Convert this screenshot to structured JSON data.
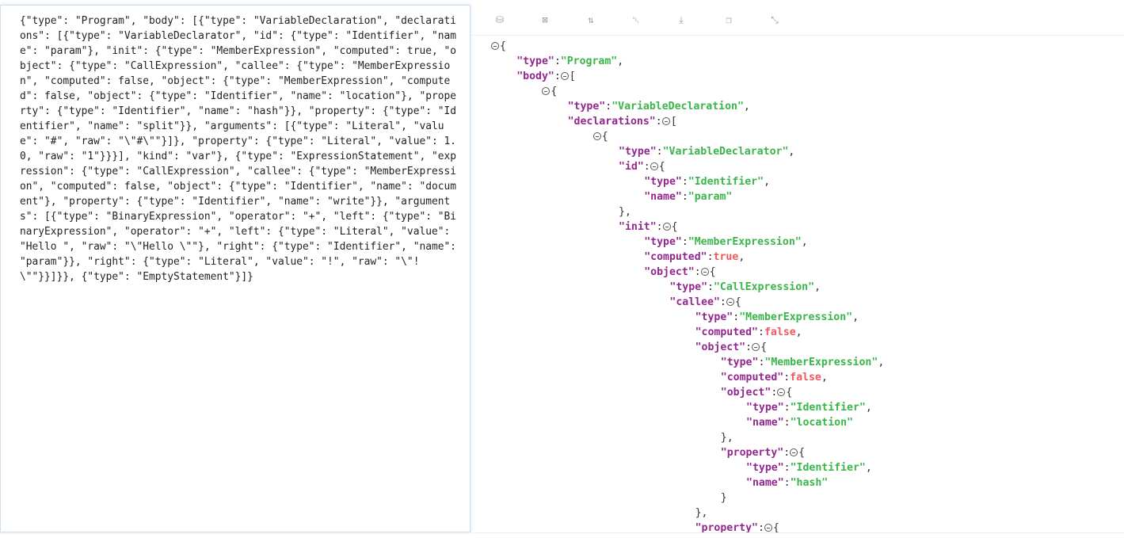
{
  "raw_json": "{\"type\": \"Program\", \"body\": [{\"type\": \"VariableDeclaration\", \"declarations\": [{\"type\": \"VariableDeclarator\", \"id\": {\"type\": \"Identifier\", \"name\": \"param\"}, \"init\": {\"type\": \"MemberExpression\", \"computed\": true, \"object\": {\"type\": \"CallExpression\", \"callee\": {\"type\": \"MemberExpression\", \"computed\": false, \"object\": {\"type\": \"MemberExpression\", \"computed\": false, \"object\": {\"type\": \"Identifier\", \"name\": \"location\"}, \"property\": {\"type\": \"Identifier\", \"name\": \"hash\"}}, \"property\": {\"type\": \"Identifier\", \"name\": \"split\"}}, \"arguments\": [{\"type\": \"Literal\", \"value\": \"#\", \"raw\": \"\\\"#\\\"\"}]}, \"property\": {\"type\": \"Literal\", \"value\": 1.0, \"raw\": \"1\"}}}], \"kind\": \"var\"}, {\"type\": \"ExpressionStatement\", \"expression\": {\"type\": \"CallExpression\", \"callee\": {\"type\": \"MemberExpression\", \"computed\": false, \"object\": {\"type\": \"Identifier\", \"name\": \"document\"}, \"property\": {\"type\": \"Identifier\", \"name\": \"write\"}}, \"arguments\": [{\"type\": \"BinaryExpression\", \"operator\": \"+\", \"left\": {\"type\": \"BinaryExpression\", \"operator\": \"+\", \"left\": {\"type\": \"Literal\", \"value\": \"Hello \", \"raw\": \"\\\"Hello \\\"\"}, \"right\": {\"type\": \"Identifier\", \"name\": \"param\"}}, \"right\": {\"type\": \"Literal\", \"value\": \"!\", \"raw\": \"\\\"!\\\"\"}}]}}, {\"type\": \"EmptyStatement\"}]}",
  "toolbar": [
    {
      "name": "database-icon",
      "glyph": "⛁"
    },
    {
      "name": "excel-icon",
      "glyph": "⊠"
    },
    {
      "name": "sort-icon",
      "glyph": "⇅"
    },
    {
      "name": "trash-icon",
      "glyph": "␡"
    },
    {
      "name": "download-icon",
      "glyph": "⤓"
    },
    {
      "name": "copy-icon",
      "glyph": "❐"
    },
    {
      "name": "collapse-icon",
      "glyph": "⤡"
    }
  ],
  "tree_lines": [
    {
      "d": 0,
      "p": [
        [
          "t",
          ""
        ],
        [
          "x",
          "{"
        ]
      ]
    },
    {
      "d": 1,
      "p": [
        [
          "k",
          "\"type\""
        ],
        [
          "x",
          ":"
        ],
        [
          "s",
          "\"Program\""
        ],
        [
          "x",
          ","
        ]
      ]
    },
    {
      "d": 1,
      "p": [
        [
          "k",
          "\"body\""
        ],
        [
          "x",
          ":"
        ],
        [
          "t",
          ""
        ],
        [
          "x",
          "["
        ]
      ]
    },
    {
      "d": 2,
      "p": [
        [
          "t",
          ""
        ],
        [
          "x",
          "{"
        ]
      ]
    },
    {
      "d": 3,
      "p": [
        [
          "k",
          "\"type\""
        ],
        [
          "x",
          ":"
        ],
        [
          "s",
          "\"VariableDeclaration\""
        ],
        [
          "x",
          ","
        ]
      ]
    },
    {
      "d": 3,
      "p": [
        [
          "k",
          "\"declarations\""
        ],
        [
          "x",
          ":"
        ],
        [
          "t",
          ""
        ],
        [
          "x",
          "["
        ]
      ]
    },
    {
      "d": 4,
      "p": [
        [
          "t",
          ""
        ],
        [
          "x",
          "{"
        ]
      ]
    },
    {
      "d": 5,
      "p": [
        [
          "k",
          "\"type\""
        ],
        [
          "x",
          ":"
        ],
        [
          "s",
          "\"VariableDeclarator\""
        ],
        [
          "x",
          ","
        ]
      ]
    },
    {
      "d": 5,
      "p": [
        [
          "k",
          "\"id\""
        ],
        [
          "x",
          ":"
        ],
        [
          "t",
          ""
        ],
        [
          "x",
          "{"
        ]
      ]
    },
    {
      "d": 6,
      "p": [
        [
          "k",
          "\"type\""
        ],
        [
          "x",
          ":"
        ],
        [
          "s",
          "\"Identifier\""
        ],
        [
          "x",
          ","
        ]
      ]
    },
    {
      "d": 6,
      "p": [
        [
          "k",
          "\"name\""
        ],
        [
          "x",
          ":"
        ],
        [
          "s",
          "\"param\""
        ]
      ]
    },
    {
      "d": 5,
      "p": [
        [
          "x",
          "},"
        ]
      ]
    },
    {
      "d": 5,
      "p": [
        [
          "k",
          "\"init\""
        ],
        [
          "x",
          ":"
        ],
        [
          "t",
          ""
        ],
        [
          "x",
          "{"
        ]
      ]
    },
    {
      "d": 6,
      "p": [
        [
          "k",
          "\"type\""
        ],
        [
          "x",
          ":"
        ],
        [
          "s",
          "\"MemberExpression\""
        ],
        [
          "x",
          ","
        ]
      ]
    },
    {
      "d": 6,
      "p": [
        [
          "k",
          "\"computed\""
        ],
        [
          "x",
          ":"
        ],
        [
          "b",
          "true"
        ],
        [
          "x",
          ","
        ]
      ]
    },
    {
      "d": 6,
      "p": [
        [
          "k",
          "\"object\""
        ],
        [
          "x",
          ":"
        ],
        [
          "t",
          ""
        ],
        [
          "x",
          "{"
        ]
      ]
    },
    {
      "d": 7,
      "p": [
        [
          "k",
          "\"type\""
        ],
        [
          "x",
          ":"
        ],
        [
          "s",
          "\"CallExpression\""
        ],
        [
          "x",
          ","
        ]
      ]
    },
    {
      "d": 7,
      "p": [
        [
          "k",
          "\"callee\""
        ],
        [
          "x",
          ":"
        ],
        [
          "t",
          ""
        ],
        [
          "x",
          "{"
        ]
      ]
    },
    {
      "d": 8,
      "p": [
        [
          "k",
          "\"type\""
        ],
        [
          "x",
          ":"
        ],
        [
          "s",
          "\"MemberExpression\""
        ],
        [
          "x",
          ","
        ]
      ]
    },
    {
      "d": 8,
      "p": [
        [
          "k",
          "\"computed\""
        ],
        [
          "x",
          ":"
        ],
        [
          "b",
          "false"
        ],
        [
          "x",
          ","
        ]
      ]
    },
    {
      "d": 8,
      "p": [
        [
          "k",
          "\"object\""
        ],
        [
          "x",
          ":"
        ],
        [
          "t",
          ""
        ],
        [
          "x",
          "{"
        ]
      ]
    },
    {
      "d": 9,
      "p": [
        [
          "k",
          "\"type\""
        ],
        [
          "x",
          ":"
        ],
        [
          "s",
          "\"MemberExpression\""
        ],
        [
          "x",
          ","
        ]
      ]
    },
    {
      "d": 9,
      "p": [
        [
          "k",
          "\"computed\""
        ],
        [
          "x",
          ":"
        ],
        [
          "b",
          "false"
        ],
        [
          "x",
          ","
        ]
      ]
    },
    {
      "d": 9,
      "p": [
        [
          "k",
          "\"object\""
        ],
        [
          "x",
          ":"
        ],
        [
          "t",
          ""
        ],
        [
          "x",
          "{"
        ]
      ]
    },
    {
      "d": 10,
      "p": [
        [
          "k",
          "\"type\""
        ],
        [
          "x",
          ":"
        ],
        [
          "s",
          "\"Identifier\""
        ],
        [
          "x",
          ","
        ]
      ]
    },
    {
      "d": 10,
      "p": [
        [
          "k",
          "\"name\""
        ],
        [
          "x",
          ":"
        ],
        [
          "s",
          "\"location\""
        ]
      ]
    },
    {
      "d": 9,
      "p": [
        [
          "x",
          "},"
        ]
      ]
    },
    {
      "d": 9,
      "p": [
        [
          "k",
          "\"property\""
        ],
        [
          "x",
          ":"
        ],
        [
          "t",
          ""
        ],
        [
          "x",
          "{"
        ]
      ]
    },
    {
      "d": 10,
      "p": [
        [
          "k",
          "\"type\""
        ],
        [
          "x",
          ":"
        ],
        [
          "s",
          "\"Identifier\""
        ],
        [
          "x",
          ","
        ]
      ]
    },
    {
      "d": 10,
      "p": [
        [
          "k",
          "\"name\""
        ],
        [
          "x",
          ":"
        ],
        [
          "s",
          "\"hash\""
        ]
      ]
    },
    {
      "d": 9,
      "p": [
        [
          "x",
          "}"
        ]
      ]
    },
    {
      "d": 8,
      "p": [
        [
          "x",
          "},"
        ]
      ]
    },
    {
      "d": 8,
      "p": [
        [
          "k",
          "\"property\""
        ],
        [
          "x",
          ":"
        ],
        [
          "t",
          ""
        ],
        [
          "x",
          "{"
        ]
      ]
    }
  ]
}
